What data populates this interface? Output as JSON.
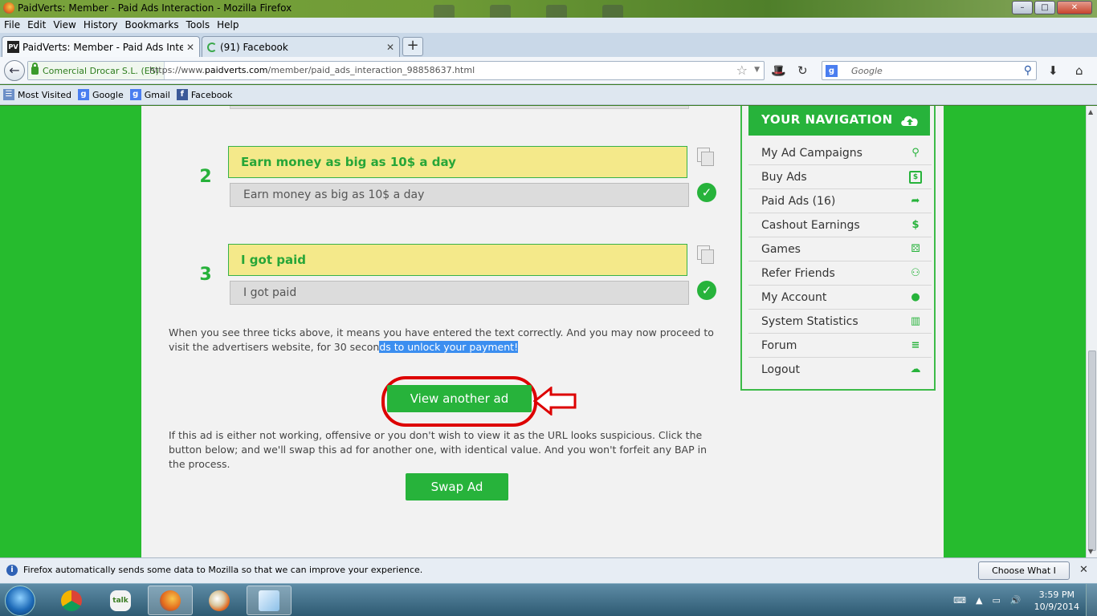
{
  "window": {
    "title": "PaidVerts: Member - Paid Ads Interaction - Mozilla Firefox",
    "controls": [
      "–",
      "□",
      "✕"
    ]
  },
  "menubar": [
    "File",
    "Edit",
    "View",
    "History",
    "Bookmarks",
    "Tools",
    "Help"
  ],
  "tabs": [
    {
      "label": "PaidVerts: Member - Paid Ads Interaction",
      "favicon": "PV",
      "close": "✕"
    },
    {
      "label": "(91) Facebook",
      "close": "✕"
    }
  ],
  "new_tab": "+",
  "navbar": {
    "back": "←",
    "identity": "Comercial Drocar S.L. (ES)",
    "url_prefix": "https://www.",
    "url_host": "paidverts.com",
    "url_path": "/member/paid_ads_interaction_98858637.html",
    "star": "☆",
    "dropdown": "▼",
    "search_engine": "g",
    "search_placeholder": "Google",
    "search_icon": "⚲",
    "tools": [
      "🎩",
      "↻",
      "⬇",
      "⌂"
    ]
  },
  "bookmarks": [
    {
      "label": "Most Visited",
      "icon": "most-visited-icon"
    },
    {
      "label": "Google",
      "icon": "google-icon"
    },
    {
      "label": "Gmail",
      "icon": "google-icon"
    },
    {
      "label": "Facebook",
      "icon": "facebook-icon"
    }
  ],
  "ad_rows": [
    {
      "number": "2",
      "phrase": "Earn money as big as 10$ a day",
      "answer": "Earn money as big as 10$ a day",
      "check": "✓"
    },
    {
      "number": "3",
      "phrase": "I got paid",
      "answer": "I got paid",
      "check": "✓"
    }
  ],
  "instructions": {
    "part1": "When you see three ticks above, it means you have entered the text correctly. And you may now proceed to visit the advertisers website, for 30 secon",
    "highlight": "ds to unlock your payment!"
  },
  "view_another_ad": "View another ad",
  "swap_text": "If this ad is either not working, offensive or you don't wish to view it as the URL looks suspicious. Click the button below; and we'll swap this ad for another one, with identical value. And you won't forfeit any BAP in the process.",
  "swap_button": "Swap Ad",
  "side_nav": {
    "heading": "YOUR NAVIGATION",
    "items": [
      {
        "label": "My Ad Campaigns",
        "glyph": "⚲"
      },
      {
        "label": "Buy Ads",
        "glyph": "$"
      },
      {
        "label": "Paid Ads (16)",
        "glyph": "➦"
      },
      {
        "label": "Cashout Earnings",
        "glyph": "$"
      },
      {
        "label": "Games",
        "glyph": "⚄"
      },
      {
        "label": "Refer Friends",
        "glyph": "⚇"
      },
      {
        "label": "My Account",
        "glyph": "●"
      },
      {
        "label": "System Statistics",
        "glyph": "▥"
      },
      {
        "label": "Forum",
        "glyph": "≡"
      },
      {
        "label": "Logout",
        "glyph": "☁"
      }
    ]
  },
  "notification": {
    "text": "Firefox automatically sends some data to Mozilla so that we can improve your experience.",
    "button": "Choose What I Share",
    "close": "✕"
  },
  "taskbar": {
    "time": "3:59 PM",
    "date": "10/9/2014"
  },
  "colors": {
    "page_green": "#26bb2e",
    "accent_green": "#27b33b",
    "phrase_yellow": "#f4e98a",
    "annotation_red": "#dd0000",
    "highlight_blue": "#3b8ef0"
  }
}
